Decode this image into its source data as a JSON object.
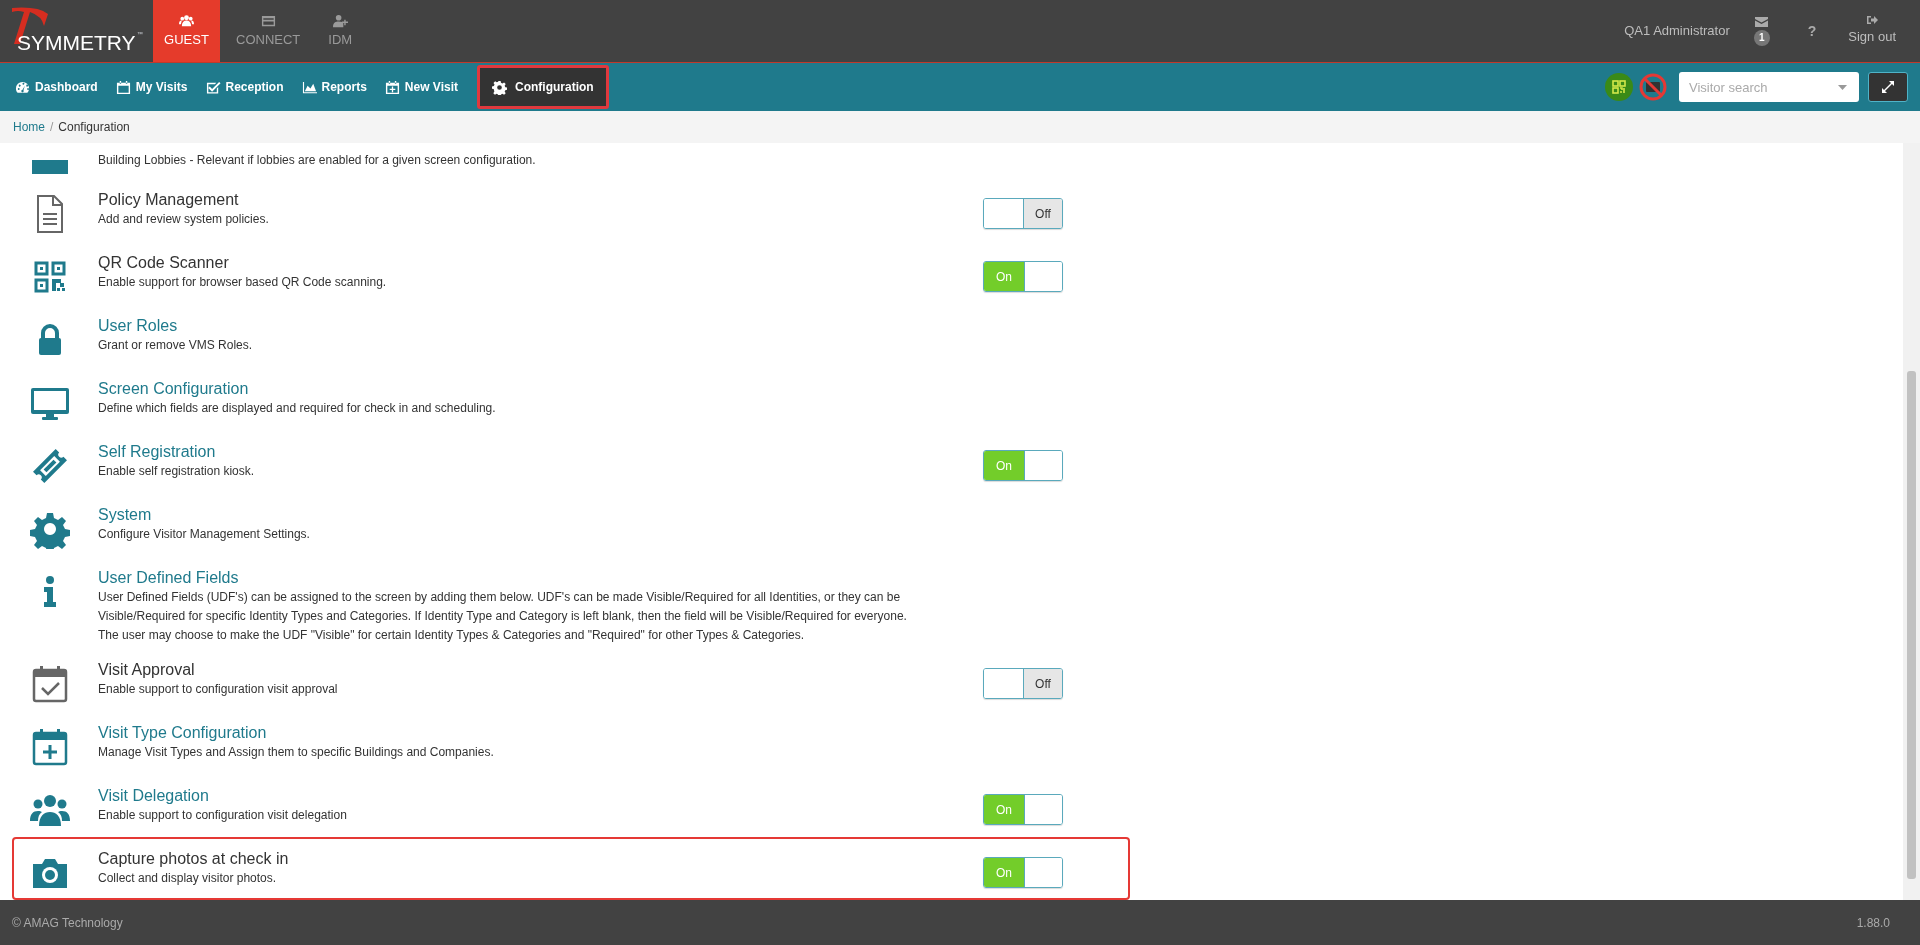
{
  "brand": {
    "name": "SYMMETRY",
    "mark": "™"
  },
  "modules": [
    {
      "label": "GUEST",
      "kind": "people",
      "selected": true
    },
    {
      "label": "CONNECT",
      "kind": "card",
      "selected": false
    },
    {
      "label": "IDM",
      "kind": "user-plus",
      "selected": false
    }
  ],
  "user": {
    "name": "QA1 Administrator",
    "message_count": "1",
    "help": "?",
    "sign_out": "Sign out"
  },
  "nav": [
    {
      "label": "Dashboard",
      "kind": "gauge",
      "selected": false
    },
    {
      "label": "My Visits",
      "kind": "calendar",
      "selected": false
    },
    {
      "label": "Reception",
      "kind": "check",
      "selected": false
    },
    {
      "label": "Reports",
      "kind": "area",
      "selected": false
    },
    {
      "label": "New Visit",
      "kind": "calendar-plus",
      "selected": false
    },
    {
      "label": "Configuration",
      "kind": "gear",
      "selected": true
    }
  ],
  "search": {
    "placeholder": "Visitor search"
  },
  "breadcrumb": {
    "items": [
      "Home",
      "Configuration"
    ],
    "separator": "/"
  },
  "settings": [
    {
      "kind": "building",
      "description": [
        "Building Lobbies - Relevant if lobbies are enabled for a given screen configuration."
      ],
      "highlighted": false
    },
    {
      "kind": "document",
      "title": "Policy Management",
      "description": [
        "Add and review system policies."
      ],
      "linked": false,
      "highlighted": false,
      "toggle": {
        "on": false,
        "label": "Off"
      }
    },
    {
      "kind": "qr",
      "title": "QR Code Scanner",
      "description": [
        "Enable support for browser based QR Code scanning."
      ],
      "linked": false,
      "highlighted": false,
      "toggle": {
        "on": true,
        "label": "On"
      }
    },
    {
      "kind": "lock",
      "title": "User Roles",
      "description": [
        "Grant or remove VMS Roles."
      ],
      "linked": true,
      "highlighted": false
    },
    {
      "kind": "monitor",
      "title": "Screen Configuration",
      "description": [
        "Define which fields are displayed and required for check in and scheduling."
      ],
      "linked": true,
      "highlighted": false
    },
    {
      "kind": "ticket",
      "title": "Self Registration",
      "description": [
        "Enable self registration kiosk."
      ],
      "linked": true,
      "highlighted": false,
      "toggle": {
        "on": true,
        "label": "On"
      }
    },
    {
      "kind": "gear",
      "title": "System",
      "description": [
        "Configure Visitor Management Settings."
      ],
      "linked": true,
      "highlighted": false
    },
    {
      "kind": "info",
      "title": "User Defined Fields",
      "description": [
        "User Defined Fields (UDF's) can be assigned to the screen by adding them below. UDF's can be made Visible/Required for all Identities, or they can be",
        "Visible/Required for specific Identity Types and Categories. If Identity Type and Category is left blank, then the field will be Visible/Required for everyone.",
        "The user may choose to make the UDF \"Visible\" for certain Identity Types & Categories and \"Required\" for other Types & Categories."
      ],
      "linked": true,
      "highlighted": false
    },
    {
      "kind": "calendar-check",
      "title": "Visit Approval",
      "description": [
        "Enable support to configuration visit approval"
      ],
      "linked": false,
      "highlighted": false,
      "toggle": {
        "on": false,
        "label": "Off"
      }
    },
    {
      "kind": "calendar-plus",
      "title": "Visit Type Configuration",
      "description": [
        "Manage Visit Types and Assign them to specific Buildings and Companies."
      ],
      "linked": true,
      "highlighted": false
    },
    {
      "kind": "users",
      "title": "Visit Delegation",
      "description": [
        "Enable support to configuration visit delegation"
      ],
      "linked": true,
      "highlighted": false,
      "toggle": {
        "on": true,
        "label": "On"
      }
    },
    {
      "kind": "camera",
      "title": "Capture photos at check in",
      "description": [
        "Collect and display visitor photos."
      ],
      "linked": false,
      "highlighted": true,
      "toggle": {
        "on": true,
        "label": "On"
      }
    }
  ],
  "footer": {
    "copyright": "© AMAG Technology",
    "version": "1.88.0"
  }
}
